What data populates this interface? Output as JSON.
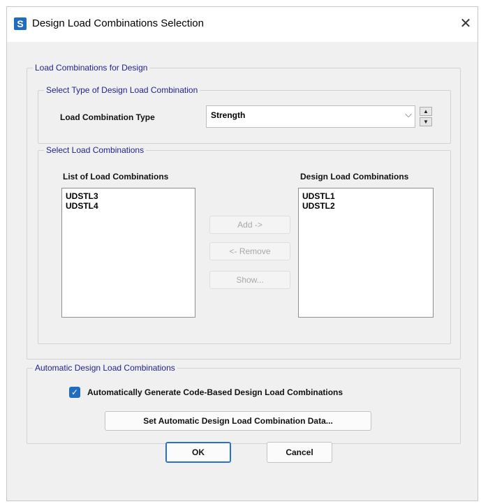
{
  "window": {
    "title": "Design Load Combinations Selection",
    "app_icon": "S"
  },
  "main_group": {
    "legend": "Load Combinations for Design",
    "type_group": {
      "legend": "Select Type of Design Load Combination",
      "type_label": "Load Combination Type",
      "type_value": "Strength"
    },
    "select_group": {
      "legend": "Select Load Combinations",
      "list_label": "List of Load Combinations",
      "design_label": "Design Load Combinations",
      "list_items": [
        "UDSTL3",
        "UDSTL4"
      ],
      "design_items": [
        "UDSTL1",
        "UDSTL2"
      ],
      "add_label": "Add ->",
      "remove_label": "<- Remove",
      "show_label": "Show..."
    }
  },
  "auto_group": {
    "legend": "Automatic Design Load Combinations",
    "checkbox_label": "Automatically Generate Code-Based Design Load Combinations",
    "checked": true,
    "set_data_label": "Set Automatic Design Load Combination Data..."
  },
  "footer": {
    "ok_label": "OK",
    "cancel_label": "Cancel"
  },
  "colors": {
    "accent": "#1f6cc0",
    "legend_text": "#1f1f8f"
  }
}
